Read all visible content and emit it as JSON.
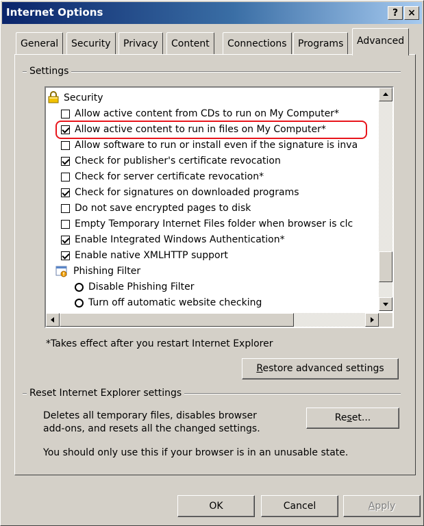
{
  "window": {
    "title": "Internet Options",
    "help_label": "?",
    "close_label": "×"
  },
  "tabs": [
    {
      "label": "General"
    },
    {
      "label": "Security"
    },
    {
      "label": "Privacy"
    },
    {
      "label": "Content"
    },
    {
      "label": "Connections"
    },
    {
      "label": "Programs"
    },
    {
      "label": "Advanced",
      "selected": true
    }
  ],
  "settings_group": {
    "label": "Settings",
    "items": [
      {
        "type": "category",
        "icon": "lock-icon",
        "label": "Security"
      },
      {
        "type": "checkbox",
        "checked": false,
        "label": "Allow active content from CDs to run on My Computer*"
      },
      {
        "type": "checkbox",
        "checked": true,
        "label": "Allow active content to run in files on My Computer*",
        "highlighted": true
      },
      {
        "type": "checkbox",
        "checked": false,
        "label": "Allow software to run or install even if the signature is inva"
      },
      {
        "type": "checkbox",
        "checked": true,
        "label": "Check for publisher's certificate revocation"
      },
      {
        "type": "checkbox",
        "checked": false,
        "label": "Check for server certificate revocation*"
      },
      {
        "type": "checkbox",
        "checked": true,
        "label": "Check for signatures on downloaded programs"
      },
      {
        "type": "checkbox",
        "checked": false,
        "label": "Do not save encrypted pages to disk"
      },
      {
        "type": "checkbox",
        "checked": false,
        "label": "Empty Temporary Internet Files folder when browser is clc"
      },
      {
        "type": "checkbox",
        "checked": true,
        "label": "Enable Integrated Windows Authentication*"
      },
      {
        "type": "checkbox",
        "checked": true,
        "label": "Enable native XMLHTTP support"
      },
      {
        "type": "category",
        "icon": "phishing-filter-icon",
        "label": "Phishing Filter"
      },
      {
        "type": "radio",
        "label": "Disable Phishing Filter"
      },
      {
        "type": "radio",
        "label": "Turn off automatic website checking"
      }
    ],
    "footnote": "*Takes effect after you restart Internet Explorer",
    "restore_button": {
      "label_pre": "",
      "label_u": "R",
      "label_post": "estore advanced settings"
    }
  },
  "reset_group": {
    "label": "Reset Internet Explorer settings",
    "description_line1": "Deletes all temporary files, disables browser",
    "description_line2": "add-ons, and resets all the changed settings.",
    "reset_button": {
      "label_pre": "Re",
      "label_u": "s",
      "label_post": "et..."
    },
    "warning": "You should only use this if your browser is in an unusable state."
  },
  "dialog_buttons": {
    "ok": "OK",
    "cancel": "Cancel",
    "apply": {
      "label_u": "A",
      "label_post": "pply"
    }
  },
  "colors": {
    "highlight": "#e8141b",
    "title_bar": "#0a246a",
    "face": "#d4d0c8"
  }
}
